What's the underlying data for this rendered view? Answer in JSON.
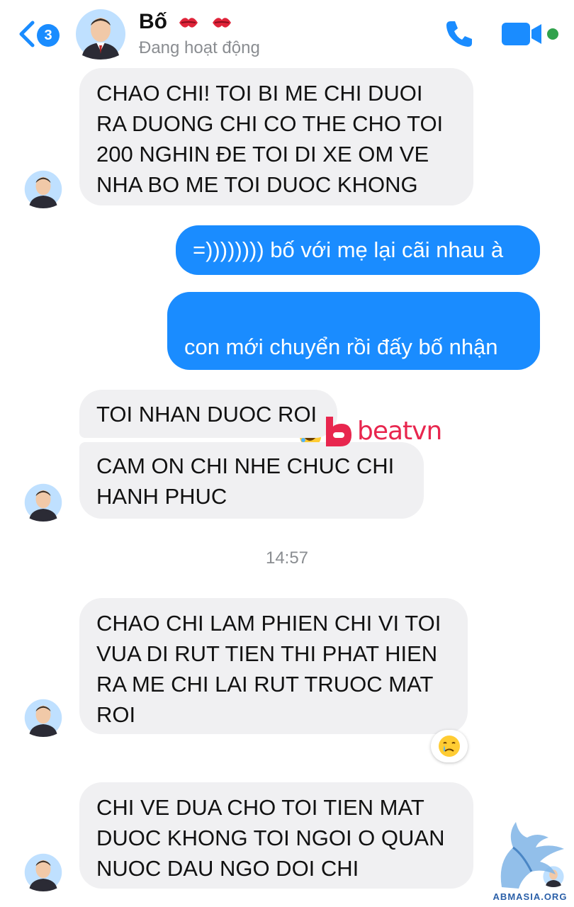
{
  "header": {
    "unread_count": "3",
    "contact_name": "Bố",
    "status": "Đang hoạt động",
    "icons": [
      "back-chevron-icon",
      "kiss-icon",
      "phone-icon",
      "video-camera-icon",
      "online-dot-icon"
    ]
  },
  "messages": [
    {
      "from": "contact",
      "text": "CHAO CHI! TOI BI ME CHI DUOI\nRA DUONG CHI CO THE CHO TOI\n200 NGHIN ĐE TOI DI XE OM VE\nNHA BO ME TOI DUOC KHONG"
    },
    {
      "from": "me",
      "text": "=)))))))) bố với mẹ lại cãi nhau à"
    },
    {
      "from": "me",
      "text": "con mới chuyển rồi đấy bố nhận\nđược chưa"
    },
    {
      "from": "contact",
      "text": "TOI NHAN DUOC ROI"
    },
    {
      "from": "contact",
      "text": "CAM ON CHI NHE CHUC CHI\nHANH PHUC"
    },
    {
      "from": "contact",
      "text": "CHAO CHI LAM PHIEN CHI VI TOI\nVUA DI RUT TIEN THI PHAT HIEN\nRA ME CHI LAI RUT TRUOC MAT\nROI"
    },
    {
      "from": "contact",
      "text": "CHI VE DUA CHO TOI TIEN MAT\nDUOC KHONG TOI NGOI O QUAN\nNUOC DAU NGO DOI CHI"
    }
  ],
  "timestamp": "14:57",
  "emojis": {
    "laughing": "rolling-on-floor-laughing-icon",
    "reaction": "crying-face-icon"
  },
  "watermarks": {
    "beatvn_logo": "beatvn",
    "abmasia_logo": "ABMASIA.ORG"
  },
  "colors": {
    "accent": "#1a8cff",
    "incoming_bubble": "#f0f0f2",
    "secondary_text": "#8a8d91",
    "online": "#31a24c"
  }
}
